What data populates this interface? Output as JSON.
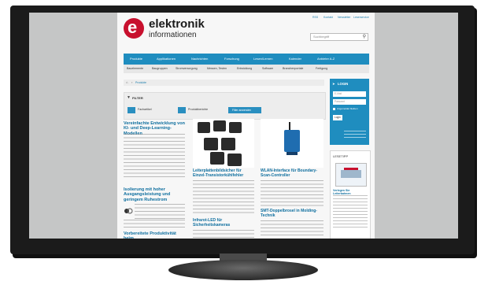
{
  "site": {
    "brand_top": "elektronik",
    "brand_bottom": "informationen",
    "logo_letter": "e",
    "top_links": [
      "RSS",
      "Kontakt",
      "Newsletter",
      "Leserservice"
    ],
    "search_placeholder": "Suchbegriff"
  },
  "nav": [
    "Produkte",
    "Applikationen",
    "Nachrichten",
    "Forschung",
    "Lesen/Lernen",
    "Kalender",
    "Anbieter A-Z"
  ],
  "subnav": [
    "Bauelemente",
    "Baugruppen",
    "Stromversorgung",
    "Messen, Testen",
    "Entwicklung",
    "Software",
    "Branchenportale",
    "Fertigung"
  ],
  "breadcrumb": "Produkte",
  "filter": {
    "title": "FILTER",
    "option1": "Fachartikel",
    "option2": "Produktberichte",
    "button": "Filter anwenden"
  },
  "articles": [
    {
      "title": "Vereinfachte Entwicklung von KI- und Deep-Learning-Modellen"
    },
    {
      "title": "Isolierung mit hoher Ausgangsleistung und geringem Ruhestrom"
    },
    {
      "title": "Vorbereitete Produktivität beim"
    },
    {
      "title": "Leiterplattenbildsicher für Einzel-Transistorkühlfehler"
    },
    {
      "title": "Infrarot-LED für Sicherheitskameras"
    },
    {
      "title": "WLAN-Interface für Boundary-Scan-Controller"
    },
    {
      "title": "SMT-Doppelbrosel in Molding-Technik"
    }
  ],
  "sidebar": {
    "login_title": "LOGIN",
    "email_placeholder": "E-Mail",
    "password_placeholder": "Passwort",
    "remember": "Angemeldet bleiben",
    "login_button": "Login",
    "lesetipp_title": "LESETIPP",
    "lesetipp_heading": "Verlegen Sie Leiterbahnen"
  },
  "colors": {
    "brand_red": "#c8102e",
    "nav_blue": "#1f8dbf",
    "heading_blue": "#0f6f9f"
  }
}
